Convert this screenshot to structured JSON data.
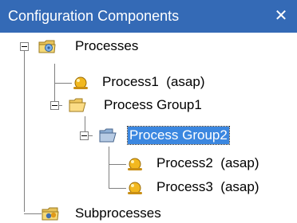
{
  "panel": {
    "title": "Configuration Components",
    "close_glyph": "✕",
    "colors": {
      "titlebar": "#346ab6",
      "selection": "#3b87e0"
    }
  },
  "tree": {
    "nodes": [
      {
        "label": "Processes",
        "icon": "processes-folder-icon",
        "expanded": true
      },
      {
        "label": "Process1  (asap)",
        "icon": "process-icon"
      },
      {
        "label": "Process Group1",
        "icon": "folder-open-icon",
        "expanded": true
      },
      {
        "label": "Process Group2",
        "icon": "folder-open-icon",
        "expanded": true,
        "selected": true
      },
      {
        "label": "Process2  (asap)",
        "icon": "process-icon"
      },
      {
        "label": "Process3  (asap)",
        "icon": "process-icon"
      },
      {
        "label": "Subprocesses",
        "icon": "subprocesses-folder-icon"
      }
    ]
  }
}
